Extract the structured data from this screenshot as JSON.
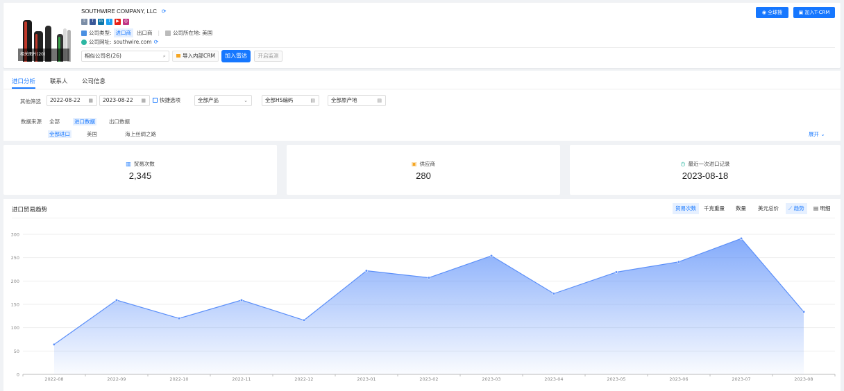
{
  "company": {
    "name": "SOUTHWIRE COMPANY, LLC",
    "photo_badge": "相关图片(20)",
    "type_label": "公司类型:",
    "type_tag": "进口商",
    "type_other": "出口商",
    "location_label": "公司所在地:",
    "location_value": "美国",
    "website_label": "公司网址:",
    "website_value": "southwire.com"
  },
  "actions": {
    "similar": "相似公司名(26)",
    "import_crm": "导入内部CRM",
    "add_radar": "加入雷达",
    "monitor": "开启监测",
    "global_search": "全球搜",
    "add_tcrm": "加入T-CRM"
  },
  "tabs": [
    "进口分析",
    "联系人",
    "公司信息"
  ],
  "filters": {
    "label": "其他筛选",
    "date_start": "2022-08-22",
    "date_end": "2023-08-22",
    "quick": "快捷选项",
    "product": "全部产品",
    "hs": "全部HS编码",
    "origin": "全部原产地",
    "source_label": "数据来源",
    "sources": [
      "全部",
      "进口数据",
      "出口数据"
    ],
    "sub_sources": [
      "全部进口",
      "美国",
      "海上丝绸之路"
    ],
    "expand": "展开"
  },
  "stats": [
    {
      "label": "贸易次数",
      "value": "2,345"
    },
    {
      "label": "供应商",
      "value": "280"
    },
    {
      "label": "最近一次进口记录",
      "value": "2023-08-18"
    }
  ],
  "chart_header": {
    "title": "进口贸易趋势",
    "metrics": [
      "贸易次数",
      "千克重量",
      "数量",
      "美元总价"
    ],
    "views": [
      "趋势",
      "明细"
    ]
  },
  "chart_data": {
    "type": "area",
    "x": [
      "2022-08",
      "2022-09",
      "2022-10",
      "2022-11",
      "2022-12",
      "2023-01",
      "2023-02",
      "2023-03",
      "2023-04",
      "2023-05",
      "2023-06",
      "2023-07",
      "2023-08"
    ],
    "series": [
      {
        "values": [
          64,
          159,
          120,
          159,
          116,
          222,
          207,
          254,
          173,
          219,
          241,
          291,
          134
        ]
      }
    ],
    "ylim": [
      0,
      300
    ],
    "yticks": [
      0,
      50,
      100,
      150,
      200,
      250,
      300
    ],
    "grid": true,
    "color": "#5b8ff9"
  }
}
